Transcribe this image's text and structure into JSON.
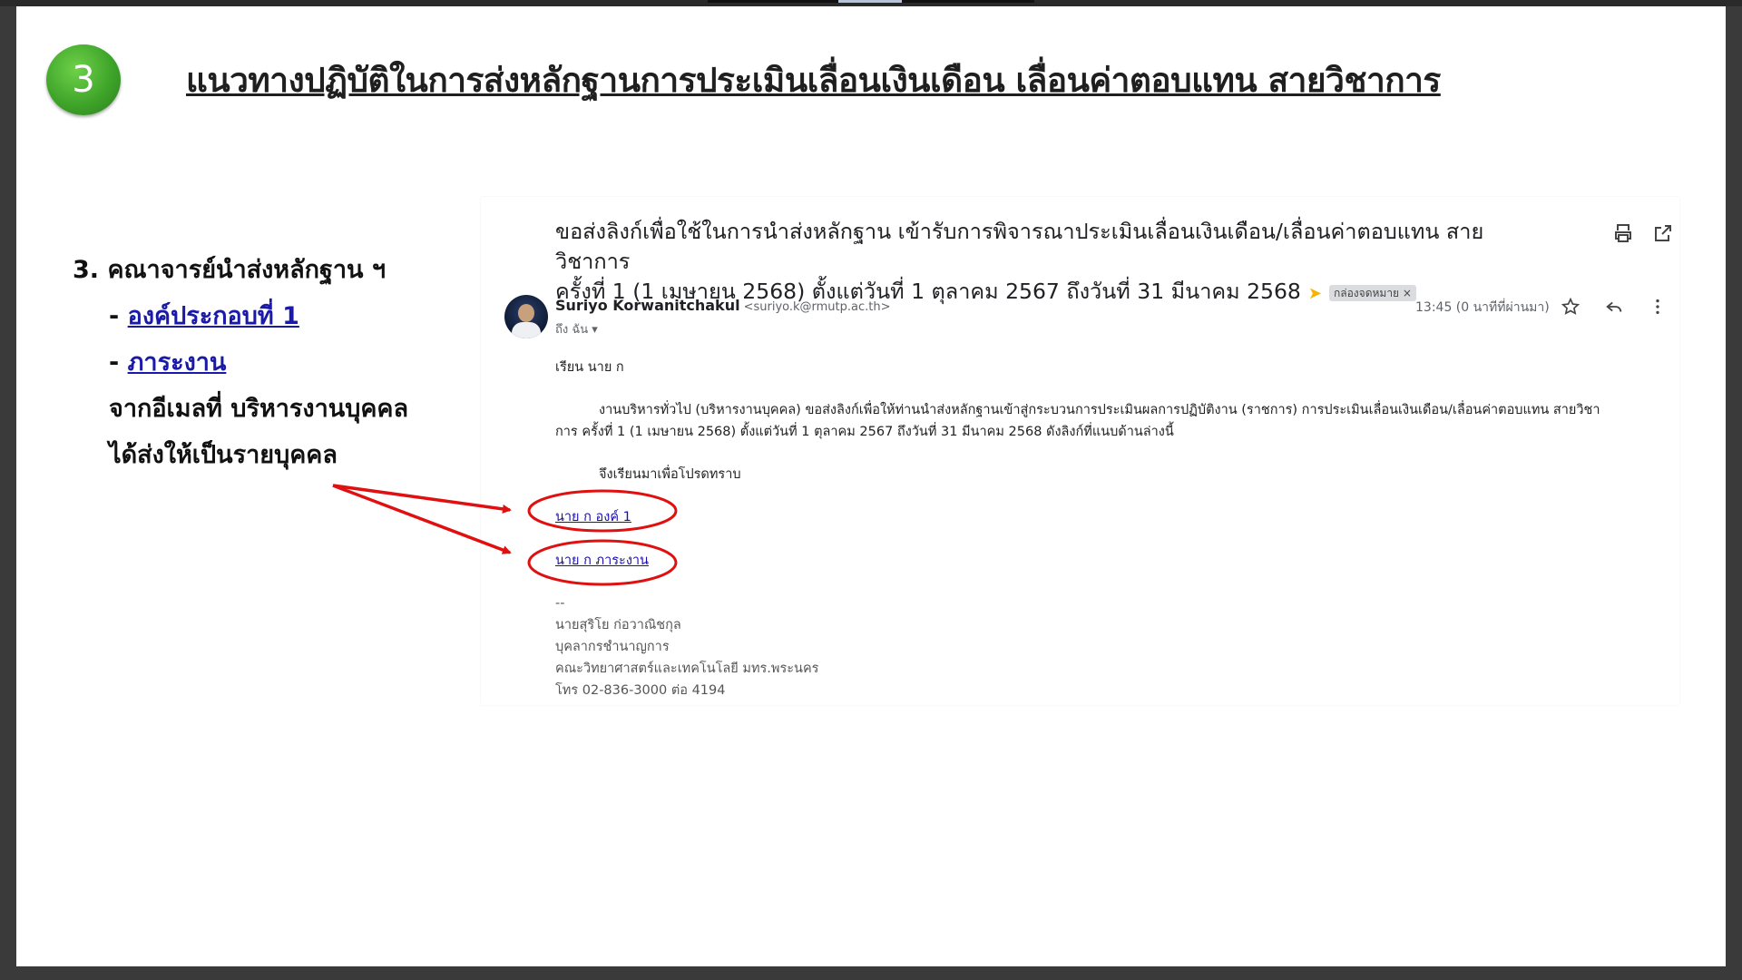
{
  "slide": {
    "step_number": "3",
    "title": "แนวทางปฏิบัติในการส่งหลักฐานการประเมินเลื่อนเงินเดือน เลื่อนค่าตอบแทน สายวิชาการ"
  },
  "left_panel": {
    "heading": "3. คณาจารย์นำส่งหลักฐาน ฯ",
    "items": [
      {
        "prefix": "- ",
        "link": "องค์ประกอบที่ 1"
      },
      {
        "prefix": "- ",
        "link": "ภาระงาน"
      }
    ],
    "line1": "จากอีเมลที่ บริหารงานบุคคล",
    "line2": "ได้ส่งให้เป็นรายบุคคล"
  },
  "email": {
    "subject_line1": "ขอส่งลิงก์เพื่อใช้ในการนำส่งหลักฐาน เข้ารับการพิจารณาประเมินเลื่อนเงินเดือน/เลื่อนค่าตอบแทน สายวิชาการ",
    "subject_line2": "ครั้งที่ 1 (1 เมษายน 2568) ตั้งแต่วันที่ 1 ตุลาคม 2567 ถึงวันที่ 31 มีนาคม 2568",
    "label_chip": "กล่องจดหมาย ×",
    "sender_name": "Suriyo Korwanitchakul",
    "sender_email": "<suriyo.k@rmutp.ac.th>",
    "to": "ถึง ฉัน ▾",
    "time": "13:45 (0 นาทีที่ผ่านมา)",
    "greeting": "เรียน   นาย ก",
    "paragraph_line1": "งานบริหารทั่วไป (บริหารงานบุคคล) ขอส่งลิงก์เพื่อให้ท่านนำส่งหลักฐานเข้าสู่กระบวนการประเมินผลการปฏิบัติงาน (ราชการ) การประเมินเลื่อนเงินเดือน/เลื่อนค่าตอบแทน สายวิชา",
    "paragraph_line2": "การ ครั้งที่ 1 (1 เมษายน 2568) ตั้งแต่วันที่ 1 ตุลาคม 2567 ถึงวันที่ 31 มีนาคม 2568 ดังลิงก์ที่แนบด้านล่างนี้",
    "closing": "จึงเรียนมาเพื่อโปรดทราบ",
    "link1": "นาย ก องค์ 1",
    "link2": "นาย ก ภาระงาน",
    "sig_dash": "--",
    "sig_name": "นายสุริโย ก่อวาณิชกุล",
    "sig_position": "บุคลากรชำนาญการ",
    "sig_faculty": "คณะวิทยาศาสตร์และเทคโนโลยี มทร.พระนคร",
    "sig_phone": "โทร 02-836-3000 ต่อ 4194"
  },
  "colors": {
    "badge_green": "#3fa52a",
    "annotation_red": "#e01010",
    "link_blue": "#1a0dab",
    "chevron_yellow": "#f4b400"
  }
}
